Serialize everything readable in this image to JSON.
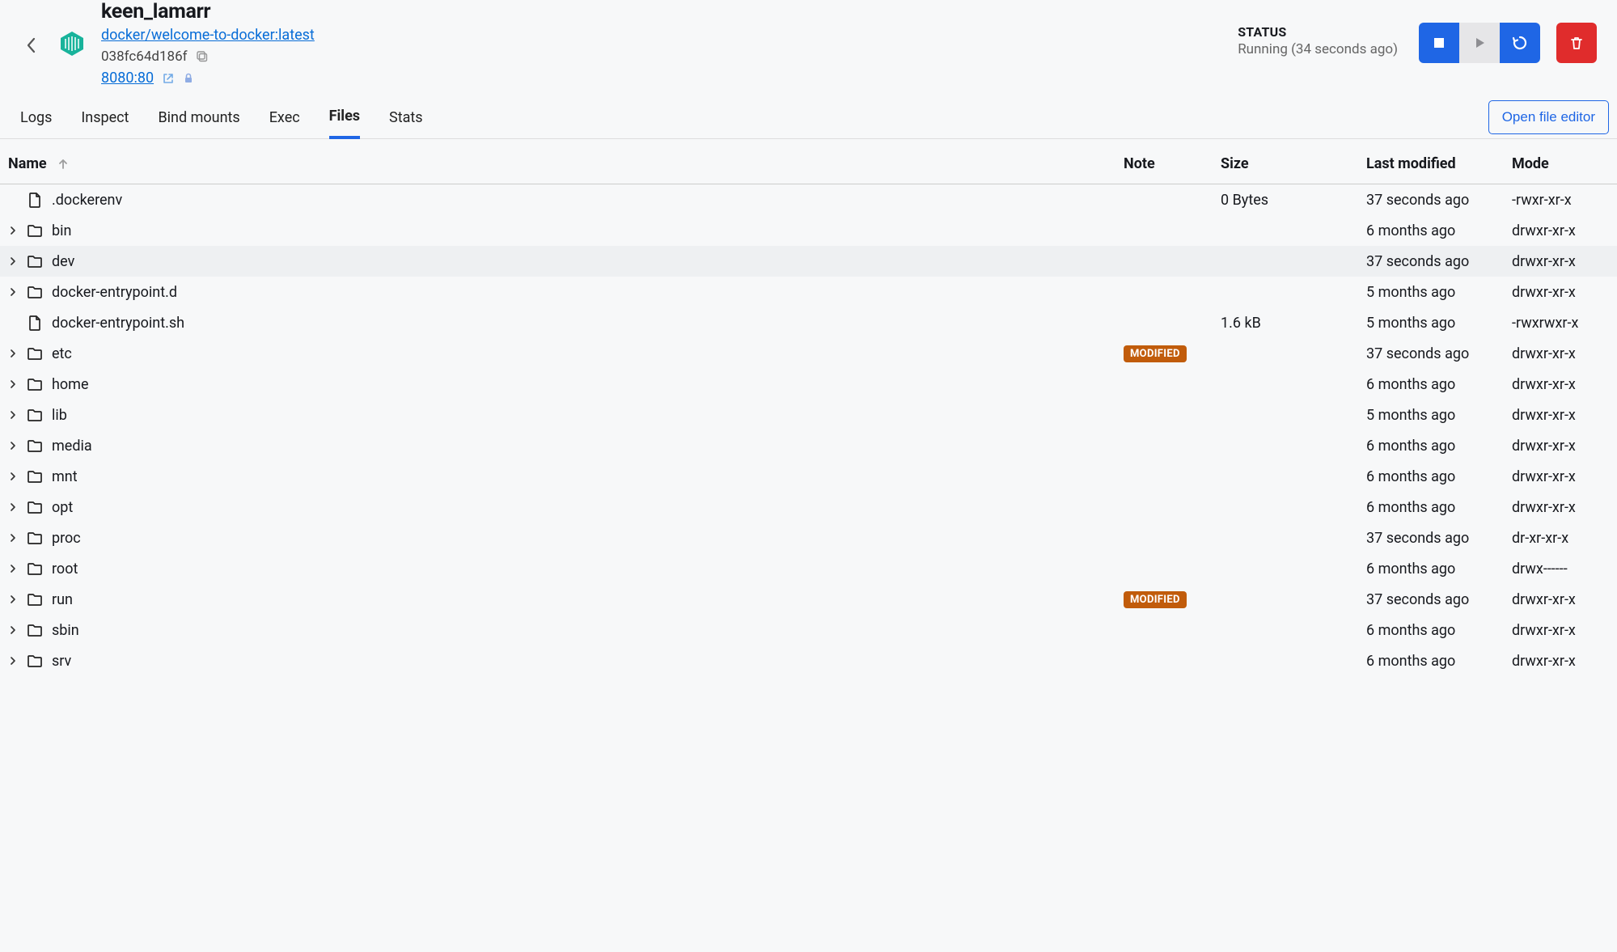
{
  "header": {
    "container_name": "keen_lamarr",
    "image_link": "docker/welcome-to-docker:latest",
    "container_id": "038fc64d186f",
    "port_link": "8080:80",
    "status_label": "STATUS",
    "status_text": "Running (34 seconds ago)"
  },
  "tabs": {
    "items": [
      "Logs",
      "Inspect",
      "Bind mounts",
      "Exec",
      "Files",
      "Stats"
    ],
    "active_index": 4,
    "open_editor_label": "Open file editor"
  },
  "table": {
    "headers": {
      "name": "Name",
      "note": "Note",
      "size": "Size",
      "modified": "Last modified",
      "mode": "Mode"
    },
    "rows": [
      {
        "name": ".dockerenv",
        "type": "file",
        "note": "",
        "size": "0 Bytes",
        "modified": "37 seconds ago",
        "mode": "-rwxr-xr-x",
        "hover": false
      },
      {
        "name": "bin",
        "type": "folder",
        "note": "",
        "size": "",
        "modified": "6 months ago",
        "mode": "drwxr-xr-x",
        "hover": false
      },
      {
        "name": "dev",
        "type": "folder",
        "note": "",
        "size": "",
        "modified": "37 seconds ago",
        "mode": "drwxr-xr-x",
        "hover": true
      },
      {
        "name": "docker-entrypoint.d",
        "type": "folder",
        "note": "",
        "size": "",
        "modified": "5 months ago",
        "mode": "drwxr-xr-x",
        "hover": false
      },
      {
        "name": "docker-entrypoint.sh",
        "type": "file",
        "note": "",
        "size": "1.6 kB",
        "modified": "5 months ago",
        "mode": "-rwxrwxr-x",
        "hover": false
      },
      {
        "name": "etc",
        "type": "folder",
        "note": "MODIFIED",
        "size": "",
        "modified": "37 seconds ago",
        "mode": "drwxr-xr-x",
        "hover": false
      },
      {
        "name": "home",
        "type": "folder",
        "note": "",
        "size": "",
        "modified": "6 months ago",
        "mode": "drwxr-xr-x",
        "hover": false
      },
      {
        "name": "lib",
        "type": "folder",
        "note": "",
        "size": "",
        "modified": "5 months ago",
        "mode": "drwxr-xr-x",
        "hover": false
      },
      {
        "name": "media",
        "type": "folder",
        "note": "",
        "size": "",
        "modified": "6 months ago",
        "mode": "drwxr-xr-x",
        "hover": false
      },
      {
        "name": "mnt",
        "type": "folder",
        "note": "",
        "size": "",
        "modified": "6 months ago",
        "mode": "drwxr-xr-x",
        "hover": false
      },
      {
        "name": "opt",
        "type": "folder",
        "note": "",
        "size": "",
        "modified": "6 months ago",
        "mode": "drwxr-xr-x",
        "hover": false
      },
      {
        "name": "proc",
        "type": "folder",
        "note": "",
        "size": "",
        "modified": "37 seconds ago",
        "mode": "dr-xr-xr-x",
        "hover": false
      },
      {
        "name": "root",
        "type": "folder",
        "note": "",
        "size": "",
        "modified": "6 months ago",
        "mode": "drwx------",
        "hover": false
      },
      {
        "name": "run",
        "type": "folder",
        "note": "MODIFIED",
        "size": "",
        "modified": "37 seconds ago",
        "mode": "drwxr-xr-x",
        "hover": false
      },
      {
        "name": "sbin",
        "type": "folder",
        "note": "",
        "size": "",
        "modified": "6 months ago",
        "mode": "drwxr-xr-x",
        "hover": false
      },
      {
        "name": "srv",
        "type": "folder",
        "note": "",
        "size": "",
        "modified": "6 months ago",
        "mode": "drwxr-xr-x",
        "hover": false
      }
    ]
  }
}
